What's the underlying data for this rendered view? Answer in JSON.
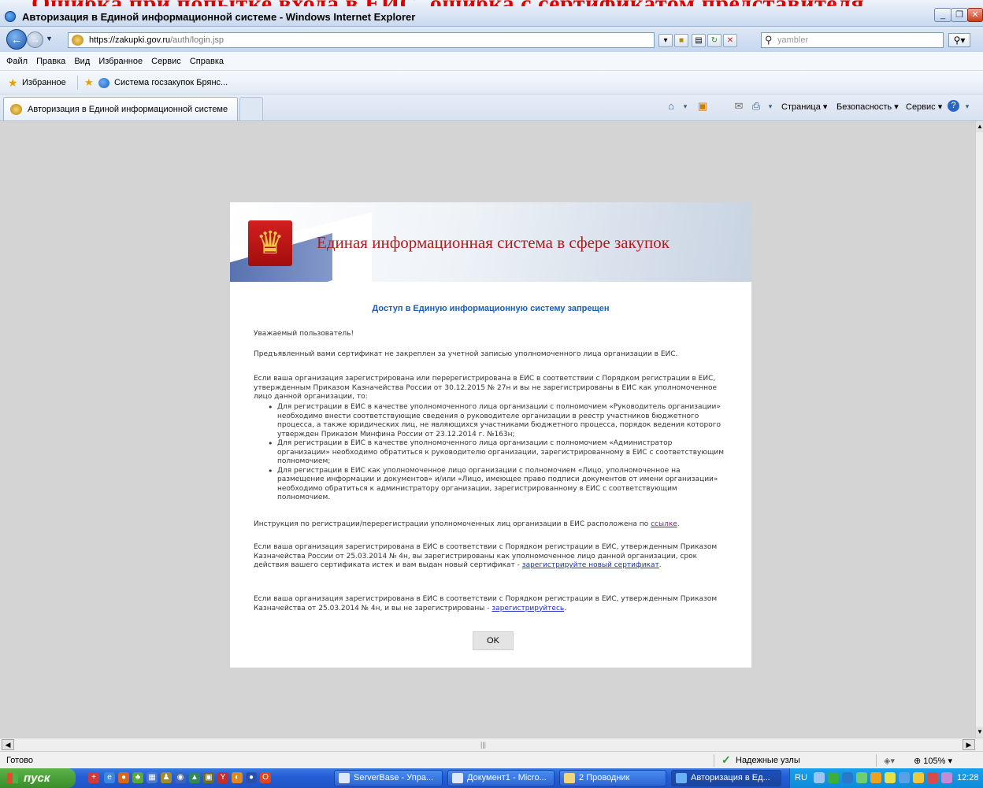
{
  "overlay_caption": "Ошибка при попытке входа в ЕИС, ошибка с сертификатом представителя",
  "window": {
    "title": "Авторизация в Единой информационной системе - Windows Internet Explorer"
  },
  "address_bar": {
    "url_host": "https://zakupki.gov.ru",
    "url_path": "/auth/login.jsp",
    "search_placeholder": "yambler"
  },
  "menu": [
    "Файл",
    "Правка",
    "Вид",
    "Избранное",
    "Сервис",
    "Справка"
  ],
  "favorites": {
    "label": "Избранное",
    "link": "Система госзакупок Брянс..."
  },
  "tabs": {
    "active": "Авторизация в Единой информационной системе"
  },
  "command_bar": {
    "page": "Страница ▾",
    "security": "Безопасность ▾",
    "tools": "Сервис ▾"
  },
  "dialog": {
    "banner_title": "Единая информационная система в сфере закупок",
    "heading": "Доступ в Единую информационную систему запрещен",
    "greeting": "Уважаемый пользователь!",
    "p1": "Предъявленный вами сертификат не закреплен за учетной записью уполномоченного лица организации в ЕИС.",
    "p2": "Если ваша организация зарегистрирована или перерегистрирована в ЕИС в соответствии с Порядком регистрации в ЕИС, утвержденным Приказом Казначейства России от 30.12.2015 № 27н и вы не зарегистрированы в ЕИС как уполномоченное лицо данной организации, то:",
    "bullets": [
      "Для регистрации в ЕИС в качестве уполномоченного лица организации с полномочием «Руководитель организации» необходимо внести соответствующие сведения о руководителе организации в реестр участников бюджетного процесса, а также юридических лиц, не являющихся участниками бюджетного процесса, порядок ведения которого утвержден Приказом Минфина России от 23.12.2014 г. №163н;",
      "Для регистрации в ЕИС в качестве уполномоченного лица организации с полномочием «Администратор организации» необходимо обратиться к руководителю организации, зарегистрированному в ЕИС с соответствующим полномочием;",
      "Для регистрации в ЕИС как уполномоченное лицо организации с полномочием «Лицо, уполномоченное на размещение информации и документов» и/или «Лицо, имеющее право подписи документов от имени организации» необходимо обратиться к администратору организации, зарегистрированному в ЕИС с соответствующим полномочием."
    ],
    "instruction_text": "Инструкция по регистрации/перерегистрации уполномоченных лиц организации в ЕИС расположена по",
    "instruction_link": "ссылке",
    "p3": "Если ваша организация зарегистрирована в ЕИС в соответствии с Порядком регистрации в ЕИС, утвержденным Приказом Казначейства России от 25.03.2014 № 4н, вы зарегистрированы как уполномоченное лицо данной организации, срок действия вашего сертификата истек и вам выдан новый сертификат  -",
    "p3_link": "зарегистрируйте новый сертификат",
    "p4": "Если ваша организация зарегистрирована в ЕИС в соответствии с Порядком регистрации в ЕИС, утвержденным Приказом Казначейства от 25.03.2014 № 4н, и вы не зарегистрированы  -",
    "p4_link": "зарегистрируйтесь",
    "ok_label": "OK"
  },
  "status_bar": {
    "text": "Готово",
    "zone": "Надежные узлы",
    "zoom": "105%"
  },
  "taskbar": {
    "start": "пуск",
    "tasks": [
      "ServerBase - Упра...",
      "Документ1 - Micro...",
      "2 Проводник",
      "Авторизация в Ед..."
    ],
    "lang": "RU",
    "clock": "12:28"
  }
}
